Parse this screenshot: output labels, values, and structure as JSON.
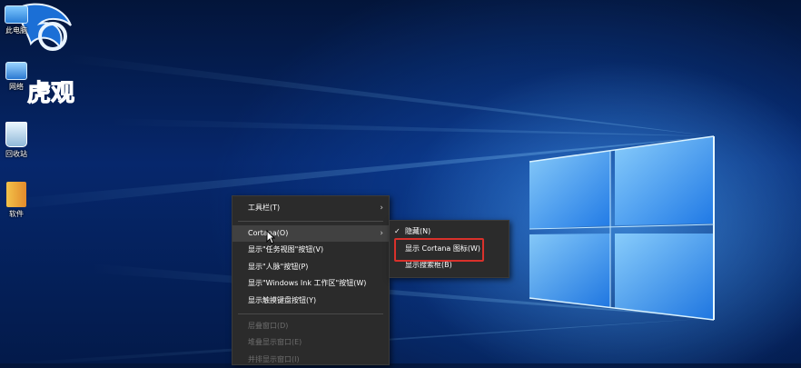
{
  "desktop": {
    "icons": [
      {
        "label": "此电脑",
        "icon": "computer-icon"
      },
      {
        "label": "网络",
        "icon": "network-icon"
      },
      {
        "label": "回收站",
        "icon": "recycle-bin-icon"
      },
      {
        "label": "软件",
        "icon": "folder-icon"
      }
    ],
    "watermark_text": "虎观",
    "colors": {
      "wallpaper_dark": "#03153a",
      "wallpaper_glow": "#4aa8ff",
      "menu_bg": "#2b2b2b",
      "highlight": "#d9312b"
    }
  },
  "context_menu": {
    "items": [
      {
        "label": "工具栏(T)",
        "has_submenu": true,
        "state": "normal"
      },
      {
        "label": "Cortana(O)",
        "has_submenu": true,
        "state": "hover"
      },
      {
        "label": "显示\"任务视图\"按钮(V)",
        "state": "normal"
      },
      {
        "label": "显示\"人脉\"按钮(P)",
        "state": "normal"
      },
      {
        "label": "显示\"Windows Ink 工作区\"按钮(W)",
        "state": "normal"
      },
      {
        "label": "显示触摸键盘按钮(Y)",
        "state": "normal"
      },
      {
        "label": "层叠窗口(D)",
        "state": "disabled"
      },
      {
        "label": "堆叠显示窗口(E)",
        "state": "disabled"
      },
      {
        "label": "并排显示窗口(I)",
        "state": "disabled"
      }
    ]
  },
  "cortana_submenu": {
    "items": [
      {
        "label": "隐藏(N)",
        "checked": true
      },
      {
        "label": "显示 Cortana 图标(W)",
        "checked": false,
        "highlighted": true
      },
      {
        "label": "显示搜索框(B)",
        "checked": false
      }
    ]
  }
}
